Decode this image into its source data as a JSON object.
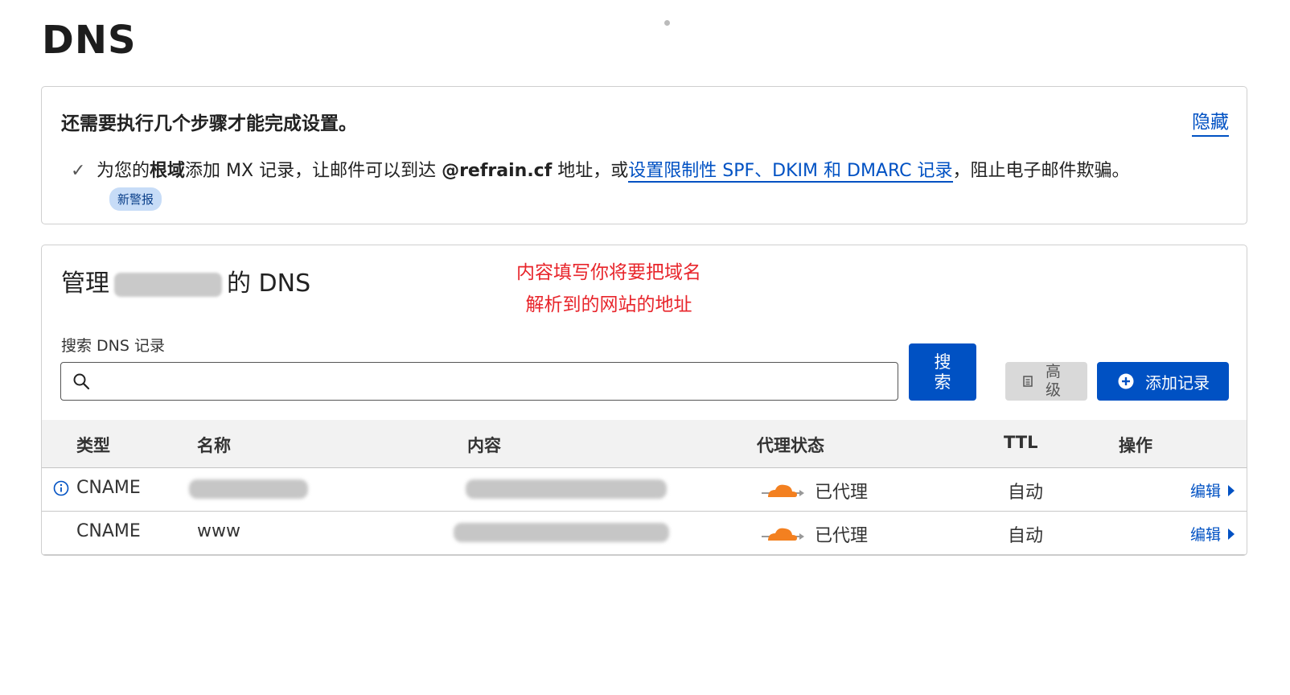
{
  "page": {
    "title": "DNS"
  },
  "notice": {
    "title": "还需要执行几个步骤才能完成设置。",
    "hide_label": "隐藏",
    "item": {
      "prefix": "为您的",
      "bold_root": "根域",
      "mid": "添加 MX 记录，让邮件可以到达 ",
      "bold_domain": "@refrain.cf",
      "mid2": " 地址，或",
      "link": "设置限制性 SPF、DKIM 和 DMARC 记录",
      "suffix": "，阻止电子邮件欺骗。"
    },
    "badge": "新警报"
  },
  "manage": {
    "title_prefix": "管理",
    "title_suffix": "的 DNS",
    "annotation_line1": "内容填写你将要把域名",
    "annotation_line2": "解析到的网站的地址",
    "search_label": "搜索 DNS 记录",
    "search_value": "",
    "search_button": "搜索",
    "advanced_button": "高级",
    "add_button": "添加记录"
  },
  "table": {
    "headers": [
      "类型",
      "名称",
      "内容",
      "代理状态",
      "TTL",
      "操作"
    ],
    "rows": [
      {
        "type": "CNAME",
        "name": "",
        "content": "",
        "proxy": "已代理",
        "ttl": "自动",
        "action": "编辑"
      },
      {
        "type": "CNAME",
        "name": "www",
        "content": "",
        "proxy": "已代理",
        "ttl": "自动",
        "action": "编辑"
      }
    ]
  },
  "colors": {
    "accent": "#0051c3",
    "annotation": "#e8252b",
    "cloud": "#f38020"
  },
  "icons": [
    "check-icon",
    "search-icon",
    "document-icon",
    "plus-circle-icon",
    "info-icon",
    "cloud-proxied-icon",
    "caret-right-icon"
  ]
}
